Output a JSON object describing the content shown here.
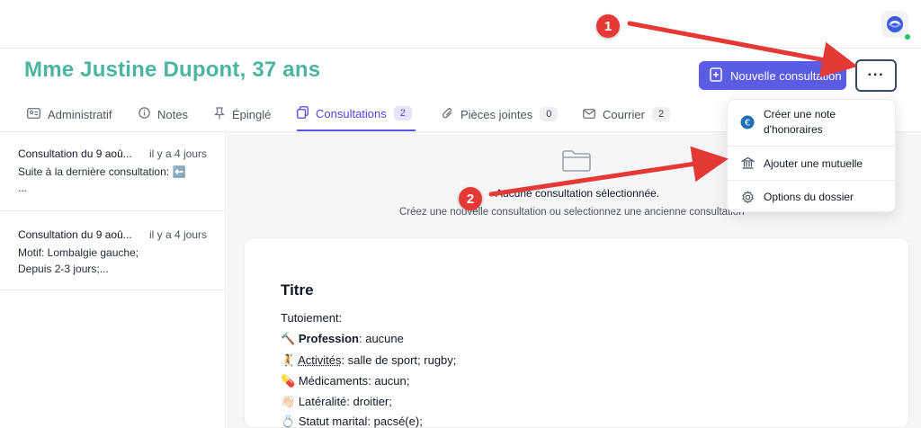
{
  "header": {
    "patient_name": "Mme Justine Dupont, 37 ans",
    "new_consult_label": "Nouvelle consultation",
    "more_label": "···"
  },
  "tabs": [
    {
      "label": "Administratif",
      "icon": "id-card-icon"
    },
    {
      "label": "Notes",
      "icon": "info-icon"
    },
    {
      "label": "Épinglé",
      "icon": "pin-icon"
    },
    {
      "label": "Consultations",
      "icon": "copy-icon",
      "badge": "2",
      "active": true
    },
    {
      "label": "Pièces jointes",
      "icon": "paperclip-icon",
      "badge": "0"
    },
    {
      "label": "Courrier",
      "icon": "mail-icon",
      "badge": "2"
    }
  ],
  "consultations": [
    {
      "title": "Consultation du 9 aoû...",
      "ago": "il y a 4 jours",
      "line1": "Suite à la dernière consultation: ⬅️",
      "line2": "..."
    },
    {
      "title": "Consultation du 9 aoû...",
      "ago": "il y a 4 jours",
      "line1": "Motif: Lombalgie gauche;",
      "line2": "Depuis 2-3 jours;..."
    }
  ],
  "empty_state": {
    "title": "Aucune consultation sélectionnée.",
    "subtitle": "Créez une nouvelle consultation ou selectionnez une ancienne consultation"
  },
  "note": {
    "title": "Titre",
    "tutoiement": "Tutoiement:",
    "lines": [
      {
        "emoji": "🔨",
        "label": "Profession",
        "value": ": aucune"
      },
      {
        "emoji": "🤾",
        "label": "Activités",
        "value": ": salle de sport; rugby;"
      },
      {
        "emoji": "💊",
        "label": "",
        "value": "Médicaments: aucun;"
      },
      {
        "emoji": "👋🏻",
        "label": "",
        "value": "Latéralité: droitier;"
      },
      {
        "emoji": "💍",
        "label": "",
        "value": "Statut marital: pacsé(e);"
      }
    ]
  },
  "menu": {
    "items": [
      {
        "label_line1": "Créer une note",
        "label_line2": "d'honoraires",
        "icon": "euro-icon"
      },
      {
        "label_line1": "Ajouter une mutuelle",
        "icon": "bank-icon"
      },
      {
        "label_line1": "Options du dossier",
        "icon": "gear-icon"
      }
    ]
  },
  "annotations": [
    {
      "number": "1",
      "target": "more-button"
    },
    {
      "number": "2",
      "target": "add-mutuelle-item"
    }
  ],
  "colors": {
    "accent": "#5b5ce6",
    "patient_name": "#4bb5a2",
    "annotation": "#e53935"
  }
}
